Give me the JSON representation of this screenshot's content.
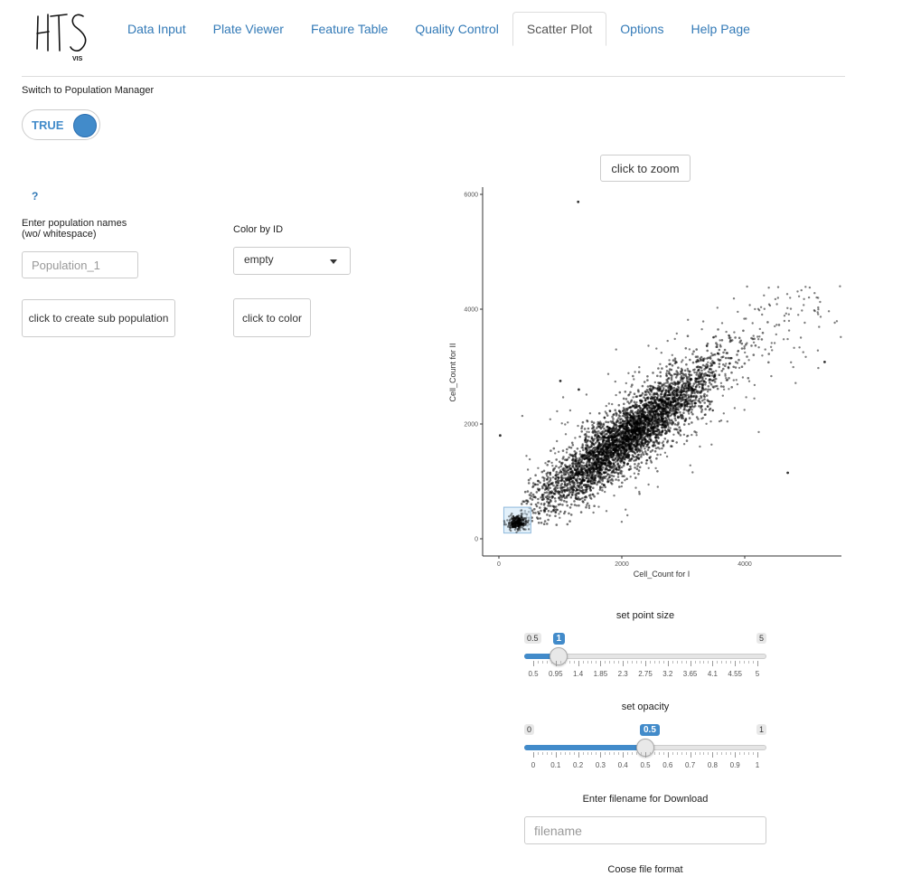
{
  "nav": {
    "tabs": [
      {
        "label": "Data Input"
      },
      {
        "label": "Plate Viewer"
      },
      {
        "label": "Feature Table"
      },
      {
        "label": "Quality Control"
      },
      {
        "label": "Scatter Plot",
        "active": true
      },
      {
        "label": "Options"
      },
      {
        "label": "Help Page"
      }
    ]
  },
  "logo": {
    "main": "HTS",
    "sub": "VIS"
  },
  "population_manager": {
    "switch_label": "Switch to Population Manager",
    "toggle_value": "TRUE",
    "help_label": "?",
    "names_label_line1": "Enter population names",
    "names_label_line2": "(wo/ whitespace)",
    "names_placeholder": "Population_1",
    "create_button": "click to create sub population",
    "color_label": "Color by ID",
    "color_selected": "empty",
    "color_button": "click to color"
  },
  "plot": {
    "zoom_button": "click to zoom",
    "point_color": "#000000",
    "selection_color": "#cfe6f7"
  },
  "chart_data": {
    "type": "scatter",
    "xlabel": "Cell_Count  for  I",
    "ylabel": "Cell_Count  for  II",
    "x_ticks": [
      0,
      2000,
      4000
    ],
    "y_ticks": [
      0,
      2000,
      4000,
      6000
    ],
    "xlim": [
      -100,
      5600
    ],
    "ylim": [
      -100,
      6200
    ],
    "grid": false,
    "main_cloud": {
      "x_range": [
        400,
        4700
      ],
      "y_range": [
        300,
        4200
      ],
      "trend_slope": 0.82,
      "approx_points": "dense"
    },
    "outliers": [
      [
        1290,
        5870
      ],
      [
        20,
        1800
      ],
      [
        4700,
        1150
      ],
      [
        5300,
        3080
      ],
      [
        1000,
        2750
      ],
      [
        1300,
        2600
      ]
    ],
    "selected_box": {
      "x": [
        80,
        520
      ],
      "y": [
        100,
        550
      ]
    }
  },
  "point_size": {
    "label": "set point size",
    "min_label": "0.5",
    "max_label": "5",
    "value_label": "1",
    "value_fraction": 0.111,
    "ticks": [
      "0.5",
      "0.95",
      "1.4",
      "1.85",
      "2.3",
      "2.75",
      "3.2",
      "3.65",
      "4.1",
      "4.55",
      "5"
    ]
  },
  "opacity": {
    "label": "set opacity",
    "min_label": "0",
    "max_label": "1",
    "value_label": "0.5",
    "value_fraction": 0.5,
    "ticks": [
      "0",
      "0.1",
      "0.2",
      "0.3",
      "0.4",
      "0.5",
      "0.6",
      "0.7",
      "0.8",
      "0.9",
      "1"
    ]
  },
  "download": {
    "filename_label": "Enter filename for Download",
    "filename_placeholder": "filename",
    "format_label": "Coose file format"
  }
}
